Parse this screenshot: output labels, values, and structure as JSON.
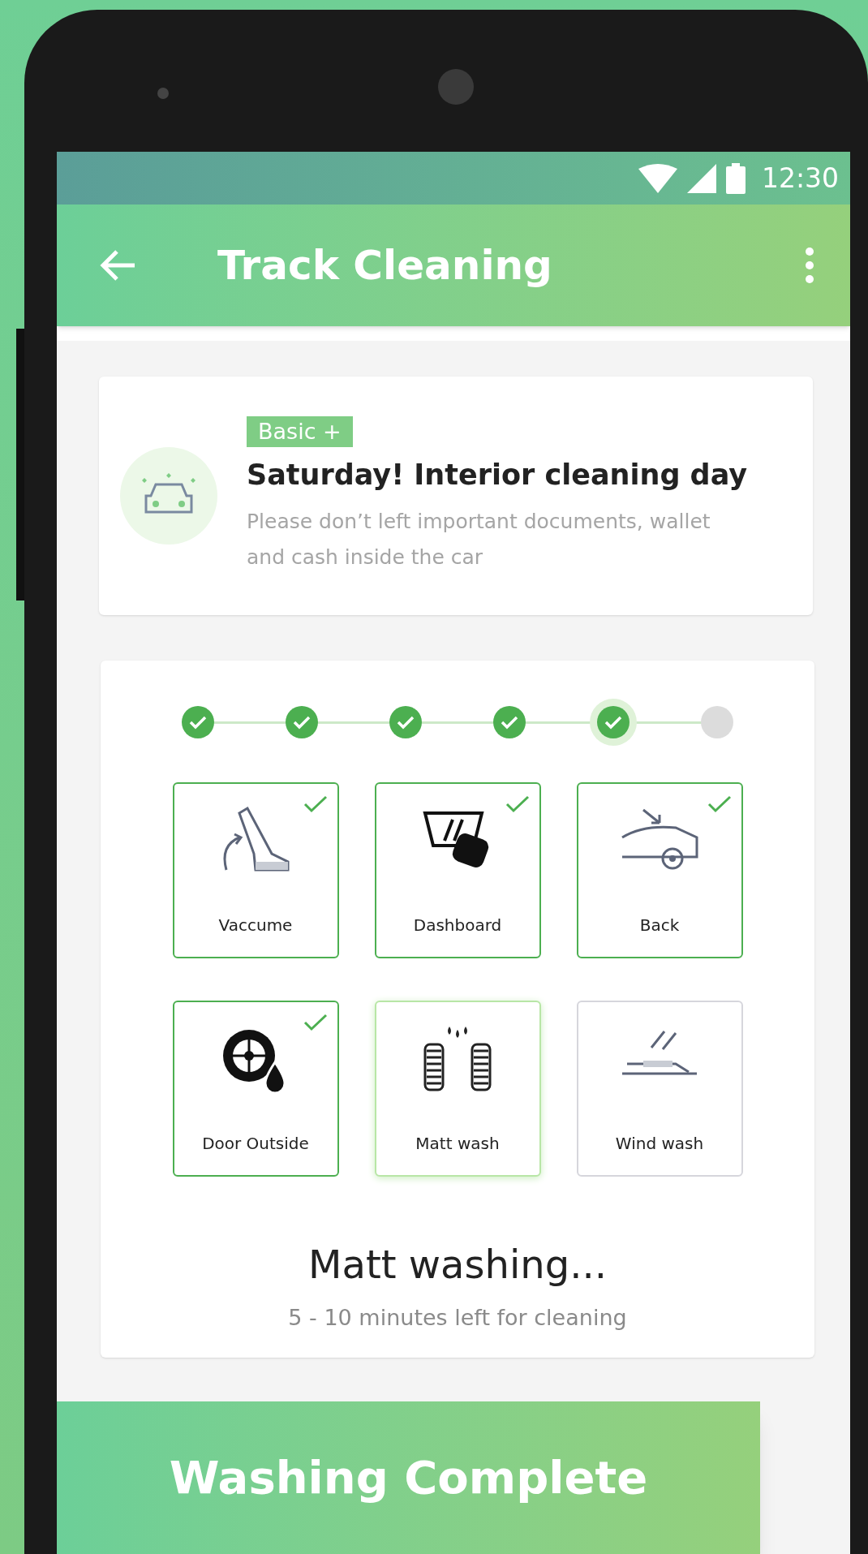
{
  "status_bar": {
    "time": "12:30"
  },
  "app_bar": {
    "title": "Track Cleaning"
  },
  "plan_card": {
    "badge": "Basic +",
    "title": "Saturday! Interior cleaning day",
    "description": "Please don’t left important documents, wallet and cash inside the car"
  },
  "steps": [
    {
      "done": true,
      "current": false
    },
    {
      "done": true,
      "current": false
    },
    {
      "done": true,
      "current": false
    },
    {
      "done": true,
      "current": false
    },
    {
      "done": true,
      "current": true
    },
    {
      "done": false,
      "current": false
    }
  ],
  "tasks": [
    {
      "kind": "vacuum",
      "label": "Vaccume",
      "done": true,
      "current": false
    },
    {
      "kind": "dashboard",
      "label": "Dashboard",
      "done": true,
      "current": false
    },
    {
      "kind": "back",
      "label": "Back",
      "done": true,
      "current": false
    },
    {
      "kind": "wheel",
      "label": "Door Outside",
      "done": true,
      "current": false
    },
    {
      "kind": "mats",
      "label": "Matt wash",
      "done": false,
      "current": true
    },
    {
      "kind": "wiper",
      "label": "Wind wash",
      "done": false,
      "current": false
    }
  ],
  "progress": {
    "heading": "Matt washing...",
    "subtitle": "5 - 10 minutes left for cleaning"
  },
  "complete_button": {
    "label": "Washing Complete"
  }
}
